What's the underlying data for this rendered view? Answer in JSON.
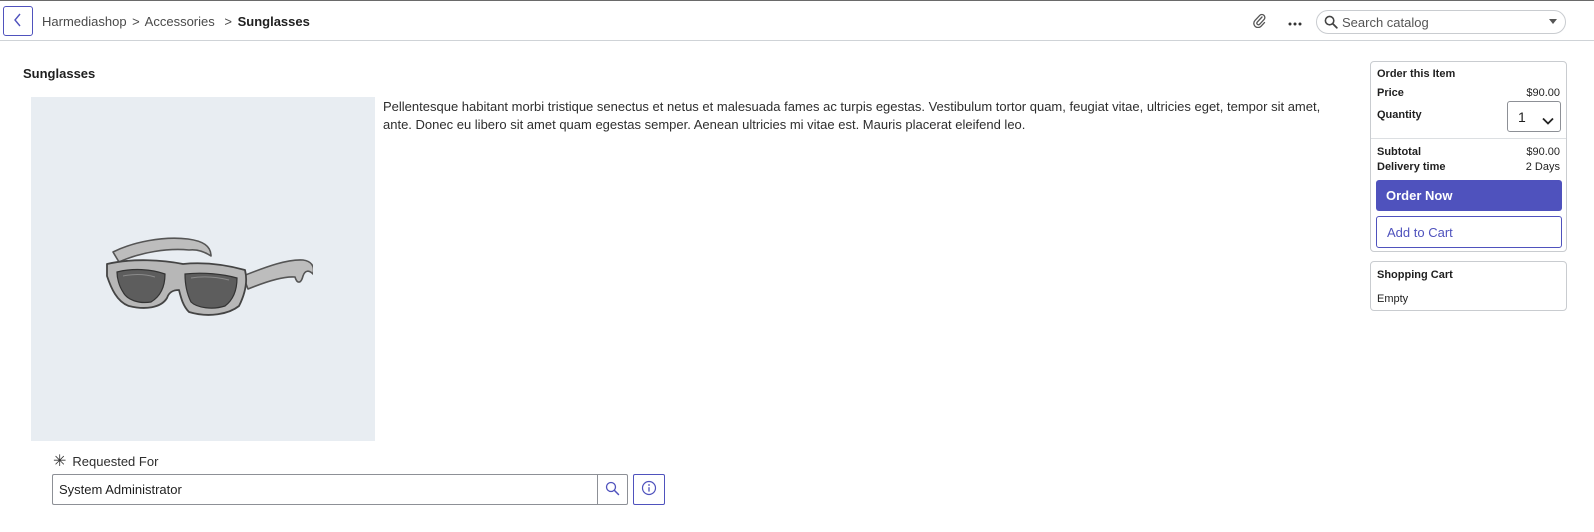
{
  "header": {
    "breadcrumb": {
      "items": [
        "Harmediashop",
        "Accessories",
        "Sunglasses"
      ],
      "separator": ">"
    },
    "search": {
      "placeholder": "Search catalog"
    },
    "icons": {
      "back": "chevron-left-icon",
      "attach": "paperclip-icon",
      "more": "ellipsis-icon",
      "search": "search-icon"
    }
  },
  "product": {
    "title": "Sunglasses",
    "description": "Pellentesque habitant morbi tristique senectus et netus et malesuada fames ac turpis egestas. Vestibulum tortor quam, feugiat vitae, ultricies eget, tempor sit amet, ante. Donec eu libero sit amet quam egestas semper. Aenean ultricies mi vitae est. Mauris placerat eleifend leo."
  },
  "form": {
    "requested_for_label": "Requested For",
    "required_marker": "✳",
    "requested_for_value": "System Administrator"
  },
  "order": {
    "heading": "Order this Item",
    "price_label": "Price",
    "price_value": "$90.00",
    "quantity_label": "Quantity",
    "quantity_value": "1",
    "subtotal_label": "Subtotal",
    "subtotal_value": "$90.00",
    "delivery_label": "Delivery time",
    "delivery_value": "2 Days",
    "order_now_label": "Order Now",
    "add_to_cart_label": "Add to Cart"
  },
  "cart": {
    "heading": "Shopping Cart",
    "status": "Empty"
  },
  "colors": {
    "accent": "#4f52bd",
    "image_background": "#e8edf2"
  }
}
